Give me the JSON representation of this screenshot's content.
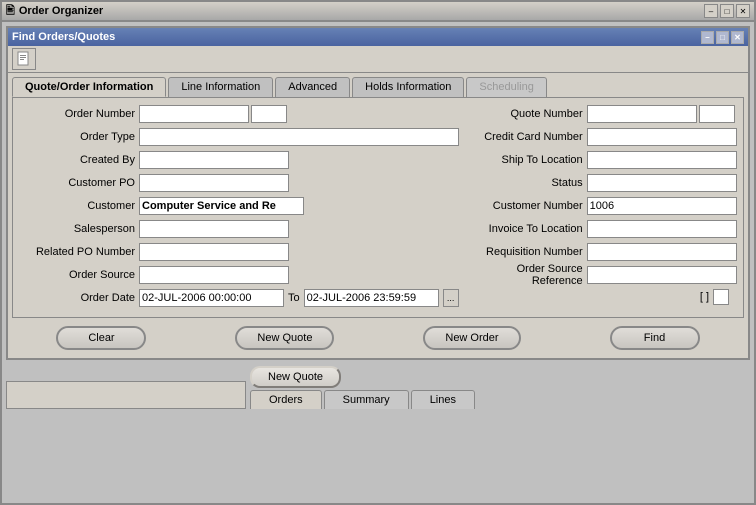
{
  "window": {
    "title": "Order Organizer",
    "close_btn": "✕",
    "min_btn": "–",
    "max_btn": "□"
  },
  "inner_panel": {
    "title": "Find  Orders/Quotes",
    "close_btn": "✕",
    "min_btn": "–",
    "max_btn": "□"
  },
  "toolbar": {
    "icon": "🖹"
  },
  "tabs": [
    {
      "label": "Quote/Order Information",
      "active": true
    },
    {
      "label": "Line Information",
      "active": false
    },
    {
      "label": "Advanced",
      "active": false
    },
    {
      "label": "Holds Information",
      "active": false
    },
    {
      "label": "Scheduling",
      "active": false,
      "disabled": true
    }
  ],
  "form_left": {
    "fields": [
      {
        "label": "Order Number",
        "value": "",
        "extra_input": true
      },
      {
        "label": "Order Type",
        "value": ""
      },
      {
        "label": "Created By",
        "value": ""
      },
      {
        "label": "Customer PO",
        "value": ""
      },
      {
        "label": "Customer",
        "value": "Computer Service and Re",
        "bold": true
      },
      {
        "label": "Salesperson",
        "value": ""
      },
      {
        "label": "Related PO Number",
        "value": ""
      },
      {
        "label": "Order Source",
        "value": ""
      }
    ],
    "order_date_label": "Order Date",
    "order_date_from": "02-JUL-2006 00:00:00",
    "order_date_to_label": "To",
    "order_date_to": "02-JUL-2006 23:59:59",
    "browse_btn": "..."
  },
  "form_right": {
    "fields": [
      {
        "label": "Quote Number",
        "value": "",
        "extra_input": true
      },
      {
        "label": "Credit Card Number",
        "value": ""
      },
      {
        "label": "Ship To Location",
        "value": ""
      },
      {
        "label": "Status",
        "value": ""
      },
      {
        "label": "Customer Number",
        "value": "1006"
      },
      {
        "label": "Invoice To Location",
        "value": ""
      },
      {
        "label": "Requisition Number",
        "value": ""
      },
      {
        "label": "Order Source Reference",
        "value": ""
      }
    ]
  },
  "checkbox": {
    "bracket_label": "[ ]"
  },
  "buttons": {
    "clear": "Clear",
    "new_quote": "New Quote",
    "new_order": "New Order",
    "find": "Find"
  },
  "bottom": {
    "new_quote_popup": "New Quote",
    "tabs": [
      {
        "label": "Orders",
        "active": true
      },
      {
        "label": "Summary",
        "active": false
      },
      {
        "label": "Lines",
        "active": false
      }
    ]
  }
}
